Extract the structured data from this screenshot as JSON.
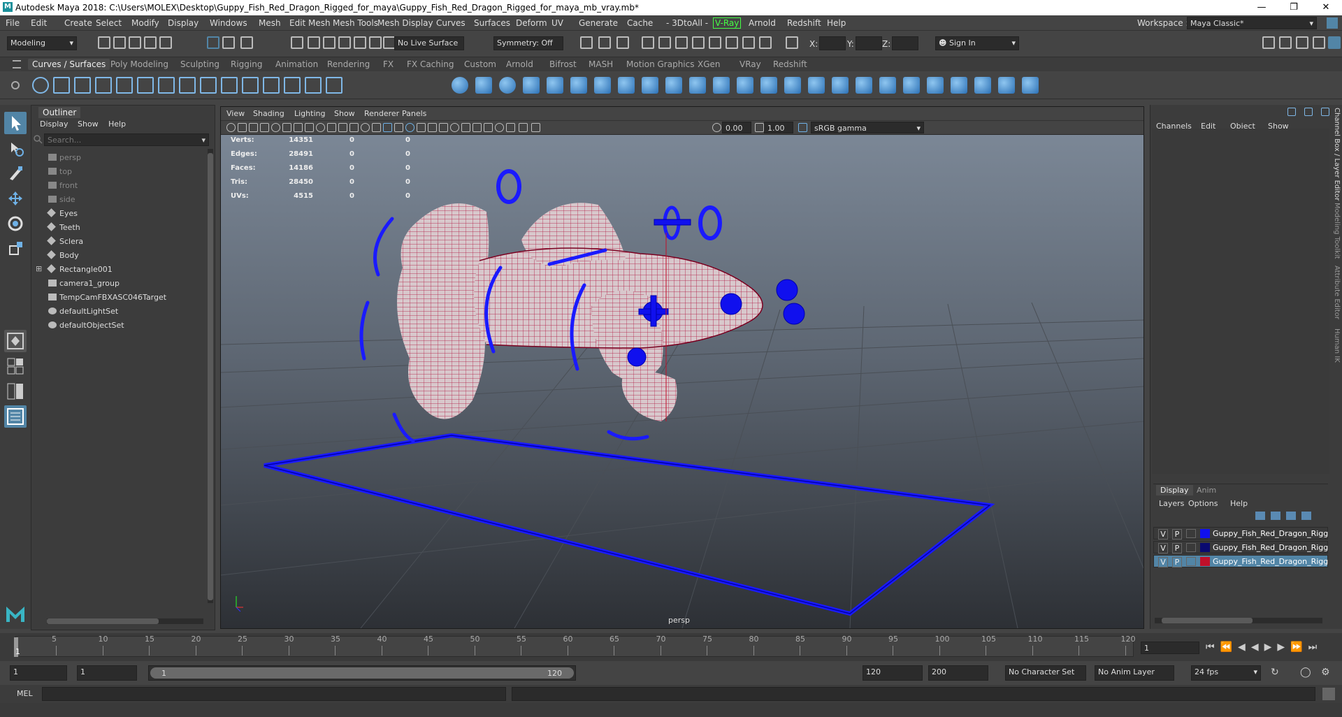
{
  "window": {
    "title": "Autodesk Maya 2018: C:\\Users\\MOLEX\\Desktop\\Guppy_Fish_Red_Dragon_Rigged_for_maya\\Guppy_Fish_Red_Dragon_Rigged_for_maya_mb_vray.mb*"
  },
  "menubar": {
    "items": [
      "File",
      "Edit",
      "Create",
      "Select",
      "Modify",
      "Display",
      "Windows",
      "Mesh",
      "Edit Mesh",
      "Mesh Tools",
      "Mesh Display",
      "Curves",
      "Surfaces",
      "Deform",
      "UV",
      "Generate",
      "Cache",
      "- 3DtoAll -",
      "V-Ray",
      "Arnold",
      "Redshift",
      "Help"
    ],
    "workspace_label": "Workspace :",
    "workspace_value": "Maya Classic*"
  },
  "statusline": {
    "mode": "Modeling",
    "live_surface": "No Live Surface",
    "symmetry": "Symmetry: Off",
    "x_label": "X:",
    "y_label": "Y:",
    "z_label": "Z:",
    "sign_in": "Sign In"
  },
  "shelf_tabs": [
    "Curves / Surfaces",
    "Poly Modeling",
    "Sculpting",
    "Rigging",
    "Animation",
    "Rendering",
    "FX",
    "FX Caching",
    "Custom",
    "Arnold",
    "Bifrost",
    "MASH",
    "Motion Graphics",
    "XGen",
    "VRay",
    "Redshift"
  ],
  "outliner": {
    "title": "Outliner",
    "menu": [
      "Display",
      "Show",
      "Help"
    ],
    "search_placeholder": "Search...",
    "items": [
      {
        "label": "persp",
        "dim": true
      },
      {
        "label": "top",
        "dim": true
      },
      {
        "label": "front",
        "dim": true
      },
      {
        "label": "side",
        "dim": true
      },
      {
        "label": "Eyes",
        "dim": false
      },
      {
        "label": "Teeth",
        "dim": false
      },
      {
        "label": "Sclera",
        "dim": false
      },
      {
        "label": "Body",
        "dim": false
      },
      {
        "label": "Rectangle001",
        "dim": false
      },
      {
        "label": "camera1_group",
        "dim": false
      },
      {
        "label": "TempCamFBXASC046Target",
        "dim": false
      },
      {
        "label": "defaultLightSet",
        "dim": false
      },
      {
        "label": "defaultObjectSet",
        "dim": false
      }
    ]
  },
  "viewport": {
    "menu": [
      "View",
      "Shading",
      "Lighting",
      "Show",
      "Renderer",
      "Panels"
    ],
    "exposure": "0.00",
    "gamma": "1.00",
    "color_space": "sRGB gamma",
    "camera_label": "persp",
    "hud": [
      {
        "label": "Verts:",
        "v1": "14351",
        "v2": "0",
        "v3": "0"
      },
      {
        "label": "Edges:",
        "v1": "28491",
        "v2": "0",
        "v3": "0"
      },
      {
        "label": "Faces:",
        "v1": "14186",
        "v2": "0",
        "v3": "0"
      },
      {
        "label": "Tris:",
        "v1": "28450",
        "v2": "0",
        "v3": "0"
      },
      {
        "label": "UVs:",
        "v1": "4515",
        "v2": "0",
        "v3": "0"
      }
    ]
  },
  "channelbox": {
    "menu": [
      "Channels",
      "Edit",
      "Object",
      "Show"
    ],
    "side_tabs": [
      "Channel Box / Layer Editor",
      "Modeling Toolkit",
      "Attribute Editor",
      "Human IK"
    ],
    "layer_tabs": [
      "Display",
      "Anim"
    ],
    "layer_menu": [
      "Layers",
      "Options",
      "Help"
    ],
    "layers": [
      {
        "v": "V",
        "p": "P",
        "name": "Guppy_Fish_Red_Dragon_Rigg",
        "color": "#1010ee",
        "selected": false
      },
      {
        "v": "V",
        "p": "P",
        "name": "Guppy_Fish_Red_Dragon_Rigg",
        "color": "#0a0a70",
        "selected": false
      },
      {
        "v": "V",
        "p": "P",
        "name": "Guppy_Fish_Red_Dragon_Rigg",
        "color": "#c0102a",
        "selected": true
      }
    ]
  },
  "timeline": {
    "ticks": [
      "5",
      "10",
      "15",
      "20",
      "25",
      "30",
      "35",
      "40",
      "45",
      "50",
      "55",
      "60",
      "65",
      "70",
      "75",
      "80",
      "85",
      "90",
      "95",
      "100",
      "105",
      "110",
      "115",
      "120"
    ],
    "current_frame_marker": "1",
    "current_frame": "1"
  },
  "range": {
    "start": "1",
    "anim_start": "1",
    "slider_start": "1",
    "slider_end": "120",
    "end": "120",
    "anim_end": "200",
    "character_set": "No Character Set",
    "anim_layer": "No Anim Layer",
    "fps": "24 fps"
  },
  "cmdline": {
    "label": "MEL"
  },
  "colors": {
    "accent": "#5285a6",
    "wire_red": "#c0102a",
    "control_blue": "#1a1aff"
  }
}
